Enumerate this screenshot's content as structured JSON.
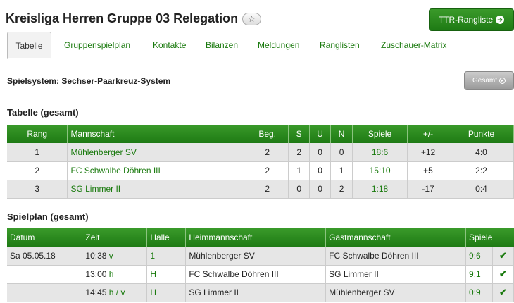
{
  "header": {
    "title": "Kreisliga Herren Gruppe 03 Relegation",
    "star_icon": "☆",
    "ttr_label": "TTR-Rangliste"
  },
  "tabs": [
    {
      "label": "Tabelle"
    },
    {
      "label": "Gruppenspielplan"
    },
    {
      "label": "Kontakte"
    },
    {
      "label": "Bilanzen"
    },
    {
      "label": "Meldungen"
    },
    {
      "label": "Ranglisten"
    },
    {
      "label": "Zuschauer-Matrix"
    }
  ],
  "spielsystem": "Spielsystem: Sechser-Paarkreuz-System",
  "gesamt_button": "Gesamt",
  "tabelle": {
    "title": "Tabelle (gesamt)",
    "headers": [
      "Rang",
      "Mannschaft",
      "Beg.",
      "S",
      "U",
      "N",
      "Spiele",
      "+/-",
      "Punkte"
    ],
    "rows": [
      {
        "rang": "1",
        "team": "Mühlenberger SV",
        "beg": "2",
        "s": "2",
        "u": "0",
        "n": "0",
        "spiele": "18:6",
        "diff": "+12",
        "punkte": "4:0"
      },
      {
        "rang": "2",
        "team": "FC Schwalbe Döhren III",
        "beg": "2",
        "s": "1",
        "u": "0",
        "n": "1",
        "spiele": "15:10",
        "diff": "+5",
        "punkte": "2:2"
      },
      {
        "rang": "3",
        "team": "SG Limmer II",
        "beg": "2",
        "s": "0",
        "u": "0",
        "n": "2",
        "spiele": "1:18",
        "diff": "-17",
        "punkte": "0:4"
      }
    ]
  },
  "spielplan": {
    "title": "Spielplan (gesamt)",
    "headers": [
      "Datum",
      "Zeit",
      "Halle",
      "Heimmannschaft",
      "Gastmannschaft",
      "Spiele"
    ],
    "rows": [
      {
        "datum": "Sa 05.05.18",
        "zeit": "10:38",
        "zeit_flag": "v",
        "halle": "1",
        "heim": "Mühlenberger SV",
        "gast": "FC Schwalbe Döhren III",
        "spiele": "9:6"
      },
      {
        "datum": "",
        "zeit": "13:00",
        "zeit_flag": "h",
        "halle": "H",
        "heim": "FC Schwalbe Döhren III",
        "gast": "SG Limmer II",
        "spiele": "9:1"
      },
      {
        "datum": "",
        "zeit": "14:45",
        "zeit_flag": "h / v",
        "halle": "H",
        "heim": "SG Limmer II",
        "gast": "Mühlenberger SV",
        "spiele": "0:9"
      }
    ],
    "check_icon": "✔"
  }
}
